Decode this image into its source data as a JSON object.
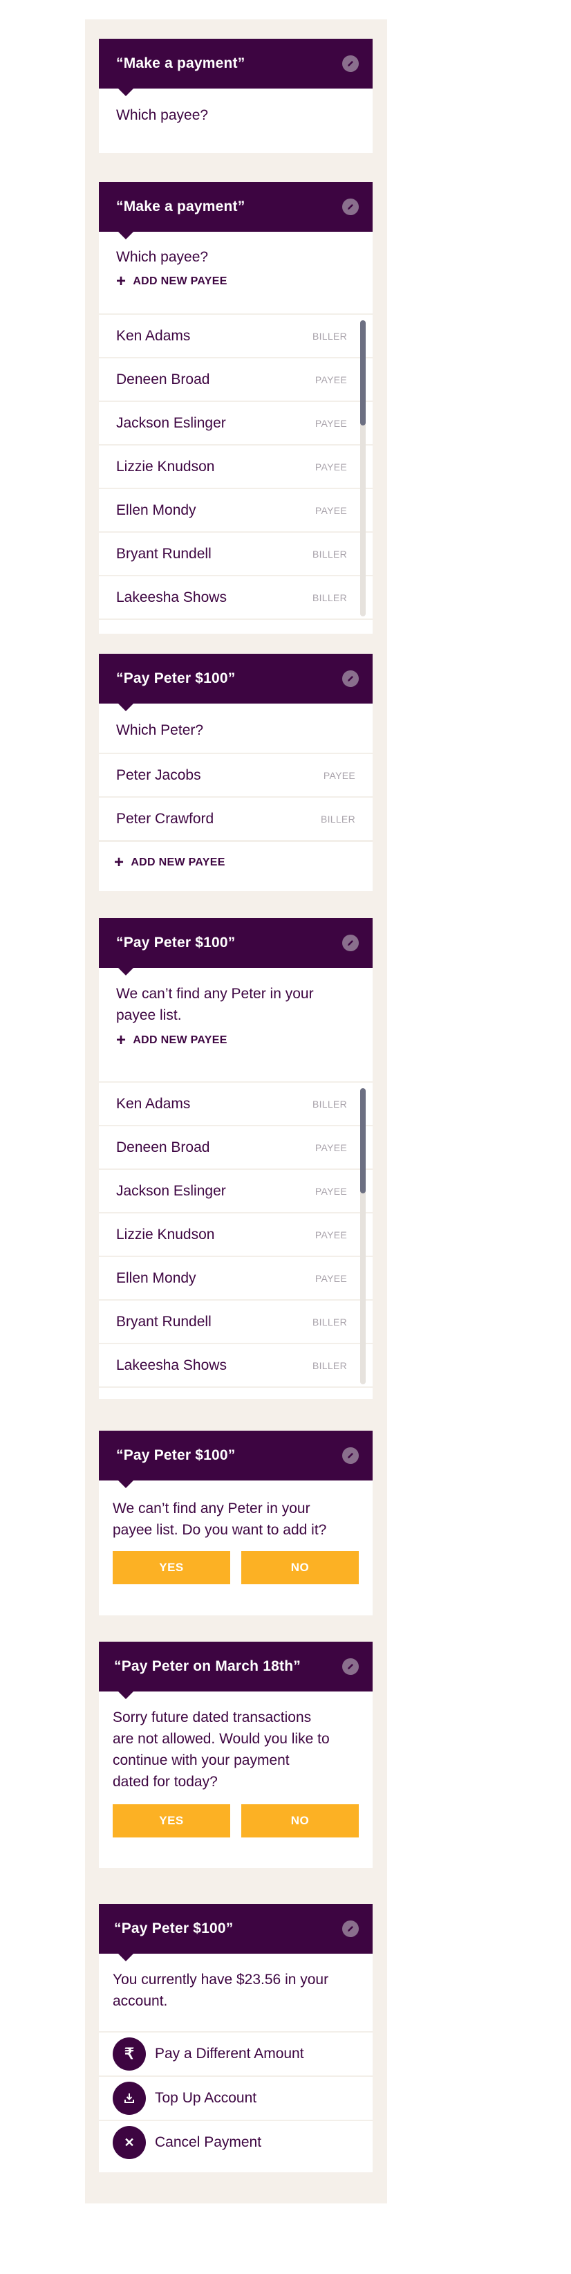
{
  "colors": {
    "header": "#3d0541",
    "panel": "#f5f0ea",
    "button": "#fcb124",
    "text": "#3d0541",
    "tag": "#a9a3ab"
  },
  "payees": [
    {
      "name": "Ken Adams",
      "type": "BILLER"
    },
    {
      "name": "Deneen Broad",
      "type": "PAYEE"
    },
    {
      "name": "Jackson Eslinger",
      "type": "PAYEE"
    },
    {
      "name": "Lizzie Knudson",
      "type": "PAYEE"
    },
    {
      "name": "Ellen Mondy",
      "type": "PAYEE"
    },
    {
      "name": "Bryant Rundell",
      "type": "BILLER"
    },
    {
      "name": "Lakeesha Shows",
      "type": "BILLER"
    }
  ],
  "cards": [
    {
      "title": "“Make a payment”",
      "question": "Which payee?",
      "edit_icon": "pencil-icon"
    },
    {
      "title": "“Make a payment”",
      "question": "Which payee?",
      "add_new": "ADD NEW PAYEE",
      "scroll_fraction_visible": 0.35
    },
    {
      "title": "“Pay Peter $100”",
      "question": "Which Peter?",
      "matches": [
        {
          "name": "Peter Jacobs",
          "type": "PAYEE"
        },
        {
          "name": "Peter Crawford",
          "type": "BILLER"
        }
      ],
      "add_new": "ADD NEW PAYEE"
    },
    {
      "title": "“Pay Peter $100”",
      "message_l1": "We can’t find any Peter in your",
      "message_l2": "payee list.",
      "add_new": "ADD NEW PAYEE",
      "scroll_fraction_visible": 0.35
    },
    {
      "title": "“Pay Peter $100”",
      "message_l1": "We can’t find any Peter in your",
      "message_l2": "payee list. Do you want to add it?",
      "yes": "YES",
      "no": "NO"
    },
    {
      "title": "“Pay Peter on March 18th”",
      "message_l1": "Sorry future dated transactions",
      "message_l2": "are not allowed. Would you like to",
      "message_l3": "continue with your payment",
      "message_l4": "dated for today?",
      "yes": "YES",
      "no": "NO"
    },
    {
      "title": "“Pay Peter $100”",
      "message_l1": "You currently have $23.56 in your",
      "message_l2": "account.",
      "actions": [
        {
          "label": "Pay a Different Amount",
          "icon": "rupee-icon",
          "glyph": "₹"
        },
        {
          "label": "Top Up Account",
          "icon": "download-icon"
        },
        {
          "label": "Cancel Payment",
          "icon": "close-icon",
          "glyph": "✕"
        }
      ]
    }
  ]
}
